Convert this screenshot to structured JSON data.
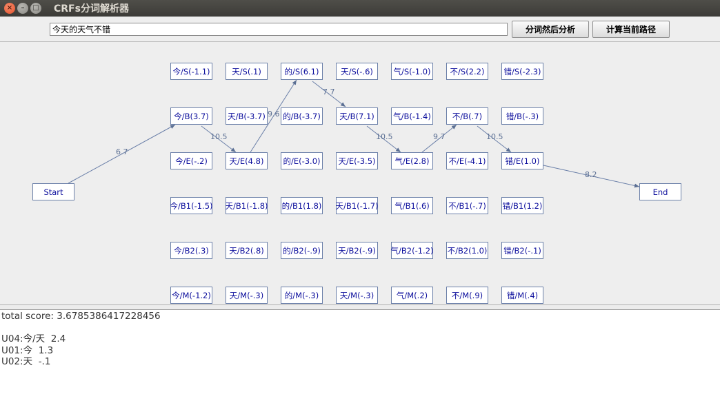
{
  "window": {
    "title": "CRFs分词解析器"
  },
  "toolbar": {
    "input_value": "今天的天气不错",
    "segment_button": "分词然后分析",
    "path_button": "计算当前路径"
  },
  "graph": {
    "columns": [
      [
        "今/S(-1.1)",
        "今/B(3.7)",
        "今/E(-.2)",
        "今/B1(-1.5)",
        "今/B2(.3)",
        "今/M(-1.2)"
      ],
      [
        "天/S(.1)",
        "天/B(-3.7)",
        "天/E(4.8)",
        "天/B1(-1.8)",
        "天/B2(.8)",
        "天/M(-.3)"
      ],
      [
        "的/S(6.1)",
        "的/B(-3.7)",
        "的/E(-3.0)",
        "的/B1(1.8)",
        "的/B2(-.9)",
        "的/M(-.3)"
      ],
      [
        "天/S(-.6)",
        "天/B(7.1)",
        "天/E(-3.5)",
        "天/B1(-1.7)",
        "天/B2(-.9)",
        "天/M(-.3)"
      ],
      [
        "气/S(-1.0)",
        "气/B(-1.4)",
        "气/E(2.8)",
        "气/B1(.6)",
        "气/B2(-1.2)",
        "气/M(.2)"
      ],
      [
        "不/S(2.2)",
        "不/B(.7)",
        "不/E(-4.1)",
        "不/B1(-.7)",
        "不/B2(1.0)",
        "不/M(.9)"
      ],
      [
        "错/S(-2.3)",
        "错/B(-.3)",
        "错/E(1.0)",
        "错/B1(1.2)",
        "错/B2(-.1)",
        "错/M(.4)"
      ]
    ],
    "start_label": "Start",
    "end_label": "End",
    "edge_labels": [
      "6.7",
      "10.5",
      "9.6",
      "7.7",
      "10.5",
      "9.7",
      "10.5",
      "8.2"
    ]
  },
  "output": {
    "line1": "total score: 3.6785386417228456",
    "line2": "",
    "line3": "U04:今/天  2.4",
    "line4": "U01:今  1.3",
    "line5": "U02:天  -.1"
  }
}
